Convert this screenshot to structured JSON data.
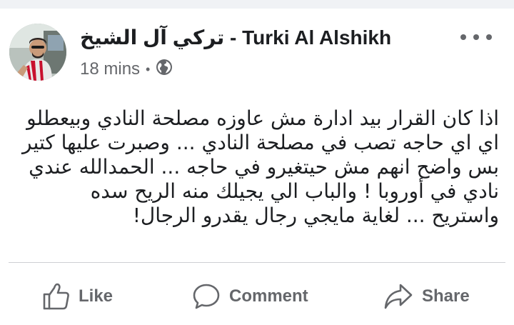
{
  "post": {
    "author": "تركي آل الشيخ - Turki Al Alshikh",
    "time": "18 mins",
    "visibility_icon": "globe-icon",
    "menu_icon": "more-options-icon",
    "text_lines": [
      "اذا كان القرار بيد ادارة مش عاوزه مصلحة النادي وبيعطلو",
      "اي اي حاجه تصب في مصلحة النادي ... وصبرت عليها كتير",
      "بس واضح انهم مش حيتغيرو في حاجه ... الحمدالله عندي",
      "نادي في أوروبا ! والباب الي يجيلك منه الريح سده",
      "واستريح ... لغاية مايجي رجال يقدرو الرجال!"
    ]
  },
  "actions": {
    "like_label": "Like",
    "comment_label": "Comment",
    "share_label": "Share"
  },
  "colors": {
    "text_primary": "#1c1e21",
    "text_secondary": "#65676b",
    "divider": "#ced0d4"
  }
}
